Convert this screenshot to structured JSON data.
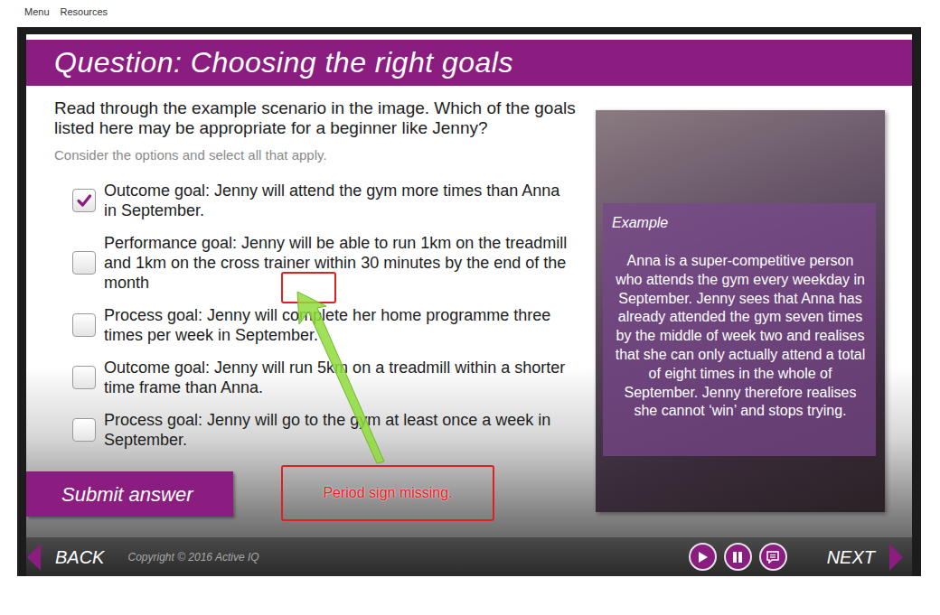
{
  "top_menu": [
    {
      "label": "Menu"
    },
    {
      "label": "Resources"
    }
  ],
  "header": {
    "title": "Question: Choosing the right goals"
  },
  "question": {
    "prompt": "Read through the example scenario in the image. Which of the goals listed here may be appropriate for a beginner like Jenny?",
    "hint": "Consider the options and select all that apply."
  },
  "options": [
    {
      "label": "Outcome goal: Jenny will attend the gym more times than Anna in September.",
      "checked": true
    },
    {
      "label": "Performance goal: Jenny will be able to run 1km on the treadmill and 1km on the cross trainer within 30 minutes by the end of the month",
      "checked": false
    },
    {
      "label": "Process goal: Jenny will complete her home programme three times per week in September.",
      "checked": false
    },
    {
      "label": "Outcome goal: Jenny will run 5km on a treadmill within a shorter time frame than Anna.",
      "checked": false
    },
    {
      "label": "Process goal: Jenny will go to the gym at least once a week in September.",
      "checked": false
    }
  ],
  "submit": {
    "label": "Submit answer"
  },
  "example": {
    "heading": "Example",
    "text": "Anna is a super-competitive person who attends the gym every weekday in September. Jenny sees that Anna has already attended the gym seven times by the middle of week two and realises that she can only actually attend a total of eight times in the whole of September. Jenny therefore realises she cannot ‘win’ and stops trying."
  },
  "annotation": {
    "text": "Period sign missing."
  },
  "footer": {
    "back": "BACK",
    "copyright": "Copyright © 2016 Active IQ",
    "next": "NEXT"
  }
}
